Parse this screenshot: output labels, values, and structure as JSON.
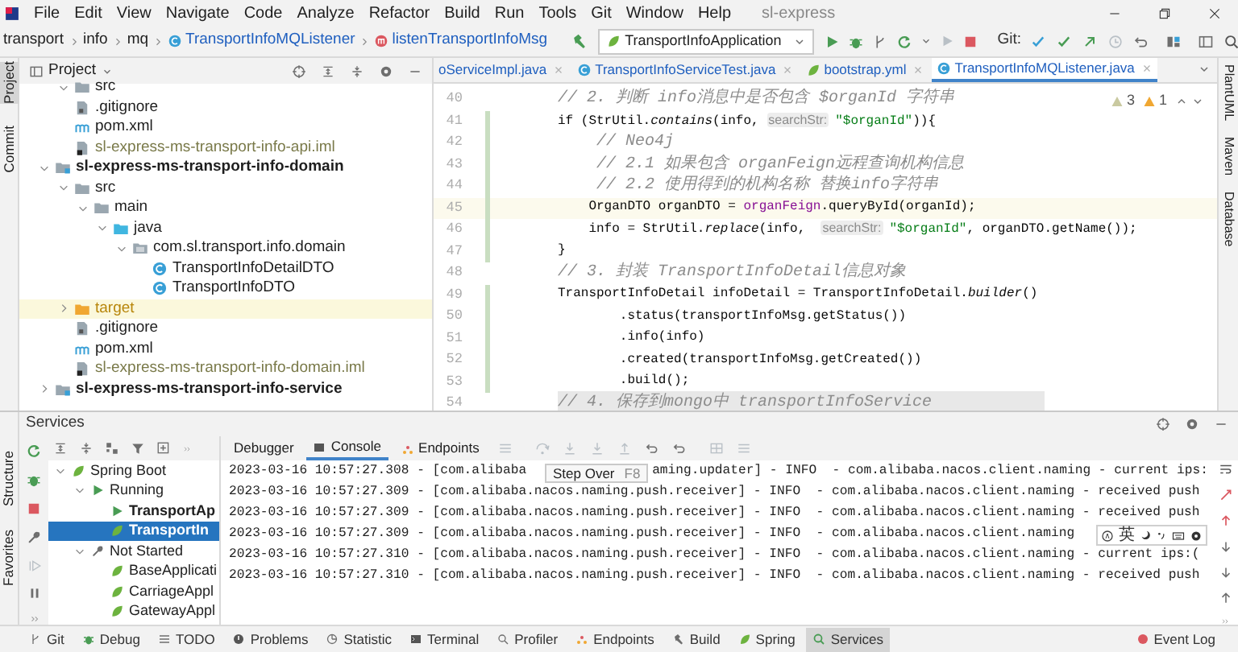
{
  "menu_bar": {
    "items": [
      "File",
      "Edit",
      "View",
      "Navigate",
      "Code",
      "Analyze",
      "Refactor",
      "Build",
      "Run",
      "Tools",
      "Git",
      "Window",
      "Help"
    ],
    "title": "sl-express"
  },
  "nav_bar": {
    "breadcrumb": [
      "transport",
      "info",
      "mq",
      "TransportInfoMQListener",
      "listenTransportInfoMsg"
    ],
    "run_config": "TransportInfoApplication",
    "git_label": "Git:"
  },
  "left_strip": [
    {
      "label": "Project",
      "selected": true
    },
    {
      "label": "Commit",
      "selected": false
    }
  ],
  "project_panel": {
    "title": "Project",
    "tree": [
      {
        "children": [
          {
            "label": "src",
            "kind": "folder",
            "expanded": true,
            "highlighted": false
          },
          {
            "label": ".gitignore",
            "kind": "gitignore",
            "highlighted": false
          },
          {
            "label": "pom.xml",
            "kind": "pom",
            "highlighted": false
          },
          {
            "label": "sl-express-ms-transport-info-api.iml",
            "kind": "iml",
            "highlighted": false
          }
        ]
      },
      {
        "label": "sl-express-ms-transport-info-domain",
        "kind": "module",
        "expanded": true,
        "highlighted": false,
        "children": [
          {
            "label": "src",
            "kind": "folder",
            "expanded": true,
            "highlighted": false,
            "children": [
              {
                "label": "main",
                "kind": "folder",
                "expanded": true,
                "highlighted": false,
                "children": [
                  {
                    "label": "java",
                    "kind": "source",
                    "expanded": true,
                    "highlighted": false,
                    "children": [
                      {
                        "label": "com.sl.transport.info.domain",
                        "kind": "package",
                        "expanded": true,
                        "highlighted": false,
                        "children": [
                          {
                            "label": "TransportInfoDetailDTO",
                            "kind": "class",
                            "highlighted": false
                          },
                          {
                            "label": "TransportInfoDTO",
                            "kind": "class",
                            "highlighted": false
                          }
                        ]
                      }
                    ]
                  }
                ]
              }
            ]
          },
          {
            "label": "target",
            "kind": "excluded",
            "expanded": false,
            "highlighted": true
          },
          {
            "label": ".gitignore",
            "kind": "gitignore",
            "highlighted": false
          },
          {
            "label": "pom.xml",
            "kind": "pom",
            "highlighted": false
          },
          {
            "label": "sl-express-ms-transport-info-domain.iml",
            "kind": "iml",
            "highlighted": false
          }
        ]
      },
      {
        "label": "sl-express-ms-transport-info-service",
        "kind": "module",
        "expanded": false,
        "highlighted": false
      }
    ]
  },
  "editor": {
    "tabs": [
      {
        "label": "oServiceImpl.java",
        "selected": false
      },
      {
        "label": "TransportInfoServiceTest.java",
        "selected": false
      },
      {
        "label": "bootstrap.yml",
        "selected": false
      },
      {
        "label": "TransportInfoMQListener.java",
        "selected": true
      }
    ],
    "inspections": {
      "warnings": "3",
      "weak_warnings": "1"
    },
    "lines": [
      {
        "number": "40",
        "changed": false,
        "current": false,
        "shaded": false,
        "tokens": [
          {
            "text": "// 2. 判断 info消息中是否包含 $organId 字符串",
            "kind": "comment"
          }
        ]
      },
      {
        "number": "41",
        "changed": true,
        "current": false,
        "shaded": false,
        "tokens": [
          {
            "text": "if (StrUtil.",
            "kind": "plain"
          },
          {
            "text": "contains",
            "kind": "static"
          },
          {
            "text": "(info, ",
            "kind": "plain"
          },
          {
            "text": "searchStr:",
            "kind": "hint"
          },
          {
            "text": "\"$organId\"",
            "kind": "string"
          },
          {
            "text": ")){",
            "kind": "plain"
          }
        ]
      },
      {
        "number": "42",
        "changed": true,
        "current": false,
        "shaded": false,
        "tokens": [
          {
            "text": "    // Neo4j",
            "kind": "comment"
          }
        ]
      },
      {
        "number": "43",
        "changed": true,
        "current": false,
        "shaded": false,
        "tokens": [
          {
            "text": "    // 2.1 如果包含 organFeign远程查询机构信息",
            "kind": "comment"
          }
        ]
      },
      {
        "number": "44",
        "changed": true,
        "current": false,
        "shaded": false,
        "tokens": [
          {
            "text": "    // 2.2 使用得到的机构名称 替换info字符串",
            "kind": "comment"
          }
        ]
      },
      {
        "number": "45",
        "changed": true,
        "current": true,
        "shaded": false,
        "tokens": [
          {
            "text": "    OrganDTO organDTO = ",
            "kind": "plain"
          },
          {
            "text": "organFeign",
            "kind": "field"
          },
          {
            "text": ".queryById(organId);",
            "kind": "plain"
          }
        ]
      },
      {
        "number": "46",
        "changed": true,
        "current": false,
        "shaded": false,
        "tokens": [
          {
            "text": "    info = StrUtil.",
            "kind": "plain"
          },
          {
            "text": "replace",
            "kind": "static"
          },
          {
            "text": "(info,  ",
            "kind": "plain"
          },
          {
            "text": "searchStr:",
            "kind": "hint"
          },
          {
            "text": "\"$organId\"",
            "kind": "string"
          },
          {
            "text": ", organDTO.getName());",
            "kind": "plain"
          }
        ]
      },
      {
        "number": "47",
        "changed": true,
        "current": false,
        "shaded": false,
        "tokens": [
          {
            "text": "}",
            "kind": "plain"
          }
        ]
      },
      {
        "number": "48",
        "changed": false,
        "current": false,
        "shaded": false,
        "tokens": [
          {
            "text": "// 3. 封装 TransportInfoDetail信息对象",
            "kind": "comment"
          }
        ]
      },
      {
        "number": "49",
        "changed": true,
        "current": false,
        "shaded": false,
        "tokens": [
          {
            "text": "TransportInfoDetail infoDetail = TransportInfoDetail.",
            "kind": "plain"
          },
          {
            "text": "builder",
            "kind": "static"
          },
          {
            "text": "()",
            "kind": "plain"
          }
        ]
      },
      {
        "number": "50",
        "changed": true,
        "current": false,
        "shaded": false,
        "tokens": [
          {
            "text": "        .status(transportInfoMsg.getStatus())",
            "kind": "plain"
          }
        ]
      },
      {
        "number": "51",
        "changed": true,
        "current": false,
        "shaded": false,
        "tokens": [
          {
            "text": "        .info(info)",
            "kind": "plain"
          }
        ]
      },
      {
        "number": "52",
        "changed": true,
        "current": false,
        "shaded": false,
        "tokens": [
          {
            "text": "        .created(transportInfoMsg.getCreated())",
            "kind": "plain"
          }
        ]
      },
      {
        "number": "53",
        "changed": true,
        "current": false,
        "shaded": false,
        "tokens": [
          {
            "text": "        .build();",
            "kind": "plain"
          }
        ]
      },
      {
        "number": "54",
        "changed": false,
        "current": false,
        "shaded": true,
        "tokens": [
          {
            "text": "// 4. 保存到mongo中 transportInfoService",
            "kind": "comment"
          }
        ]
      }
    ]
  },
  "right_strip": [
    "PlantUML",
    "Maven",
    "Database"
  ],
  "services": {
    "title": "Services",
    "side_strip": [
      "Structure",
      "Favorites"
    ],
    "tree": [
      {
        "label": "Spring Boot",
        "kind": "group",
        "expanded": true,
        "selected": false,
        "children": [
          {
            "label": "Running",
            "kind": "running",
            "expanded": true,
            "selected": false,
            "children": [
              {
                "label": "TransportAp",
                "kind": "app-running",
                "selected": false
              },
              {
                "label": "TransportIn",
                "kind": "app-running",
                "selected": true
              }
            ]
          },
          {
            "label": "Not Started",
            "kind": "stopped",
            "expanded": true,
            "selected": false,
            "children": [
              {
                "label": "BaseApplicati",
                "kind": "app",
                "selected": false
              },
              {
                "label": "CarriageAppl",
                "kind": "app",
                "selected": false
              },
              {
                "label": "GatewayAppl",
                "kind": "app",
                "selected": false
              }
            ]
          }
        ]
      }
    ],
    "console_tabs": [
      {
        "label": "Debugger",
        "selected": false
      },
      {
        "label": "Console",
        "selected": true
      },
      {
        "label": "Endpoints",
        "selected": false
      }
    ],
    "console_lines": [
      {
        "segments": [
          "2023-03-16 10:57:27.308 - [com.alibaba",
          "aming.updater] - INFO  - com.alibaba.nacos.client.naming - current ips:"
        ]
      },
      {
        "segments": [
          "2023-03-16 10:57:27.309 - [com.alibaba.nacos.naming.push.receiver] - INFO  - com.alibaba.nacos.client.naming - received push"
        ]
      },
      {
        "segments": [
          "2023-03-16 10:57:27.309 - [com.alibaba.nacos.naming.push.receiver] - INFO  - com.alibaba.nacos.client.naming - received push"
        ]
      },
      {
        "segments": [
          "2023-03-16 10:57:27.309 - [com.alibaba.nacos.naming.push.receiver] - INFO  - com.alibaba.nacos.client.naming"
        ]
      },
      {
        "segments": [
          "2023-03-16 10:57:27.310 - [com.alibaba.nacos.naming.push.receiver] - INFO  - com.alibaba.nacos.client.naming - current ips:("
        ]
      },
      {
        "segments": [
          "2023-03-16 10:57:27.310 - [com.alibaba.nacos.naming.push.receiver] - INFO  - com.alibaba.nacos.client.naming - received push"
        ]
      }
    ],
    "tooltip": {
      "label": "Step Over",
      "shortcut": "F8"
    },
    "ime_toolbar": {
      "label": "英"
    }
  },
  "bottom_bar": {
    "items": [
      {
        "label": "Git",
        "selected": false
      },
      {
        "label": "Debug",
        "selected": false
      },
      {
        "label": "TODO",
        "selected": false
      },
      {
        "label": "Problems",
        "selected": false
      },
      {
        "label": "Statistic",
        "selected": false
      },
      {
        "label": "Terminal",
        "selected": false
      },
      {
        "label": "Profiler",
        "selected": false
      },
      {
        "label": "Endpoints",
        "selected": false
      },
      {
        "label": "Build",
        "selected": false
      },
      {
        "label": "Spring",
        "selected": false
      },
      {
        "label": "Services",
        "selected": true
      }
    ],
    "event_log": "Event Log"
  }
}
